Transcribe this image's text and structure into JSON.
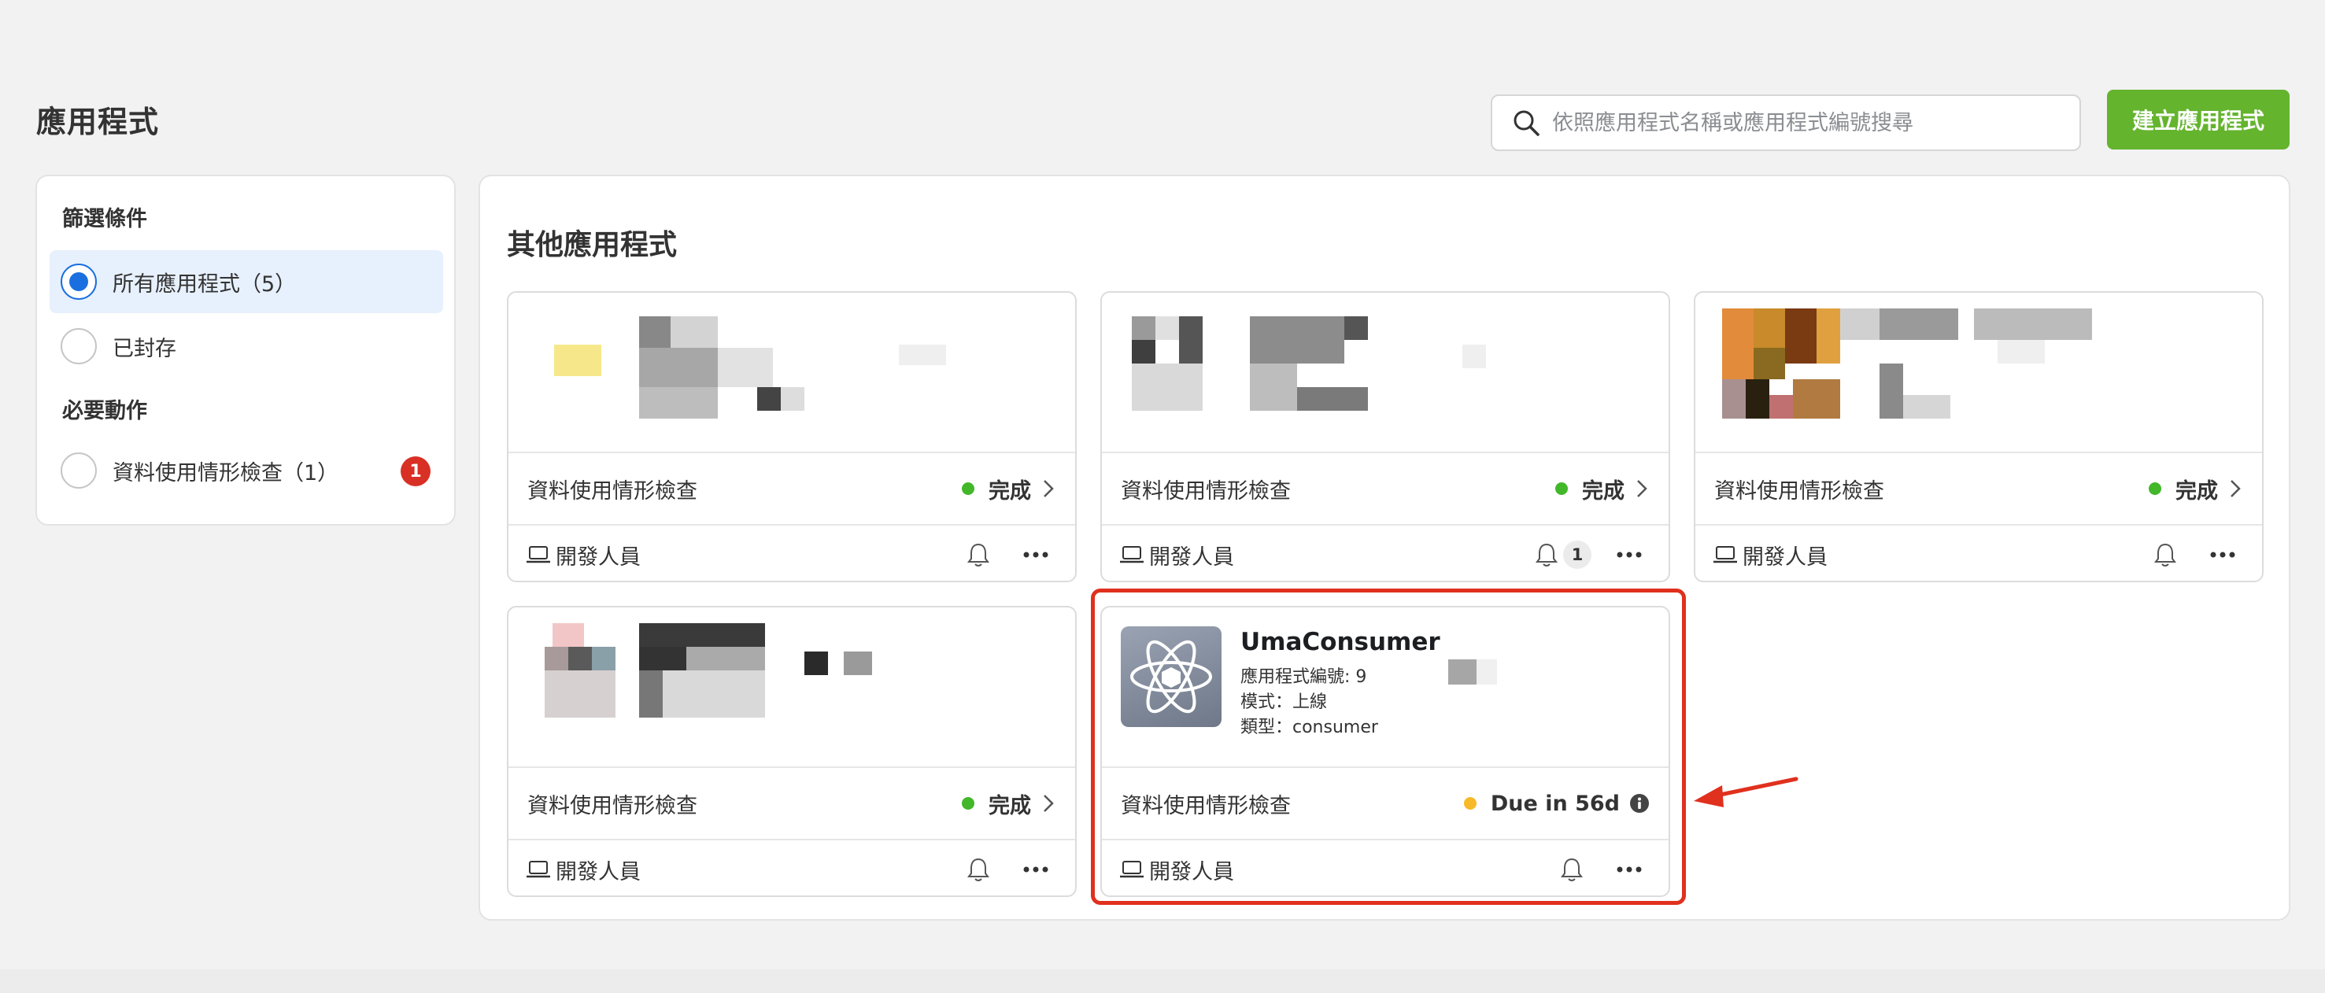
{
  "page": {
    "title": "應用程式"
  },
  "search": {
    "placeholder": "依照應用程式名稱或應用程式編號搜尋"
  },
  "header": {
    "create_label": "建立應用程式"
  },
  "sidebar": {
    "filter_title": "篩選條件",
    "items": [
      {
        "label": "所有應用程式（5）",
        "selected": true
      },
      {
        "label": "已封存",
        "selected": false
      }
    ],
    "required_title": "必要動作",
    "required_items": [
      {
        "label": "資料使用情形檢查（1）",
        "badge": "1"
      }
    ]
  },
  "main": {
    "section_title": "其他應用程式",
    "cards": [
      {
        "review_label": "資料使用情形檢查",
        "status": "完成",
        "role": "開發人員"
      },
      {
        "review_label": "資料使用情形檢查",
        "status": "完成",
        "role": "開發人員",
        "notif_count": "1"
      },
      {
        "review_label": "資料使用情形檢查",
        "status": "完成",
        "role": "開發人員"
      },
      {
        "review_label": "資料使用情形檢查",
        "status": "完成",
        "role": "開發人員"
      },
      {
        "name": "UmaConsumer",
        "app_id_label": "應用程式編號: 9",
        "mode_label": "模式：上線",
        "type_label": "類型：consumer",
        "review_label": "資料使用情形檢查",
        "status": "Due in 56d",
        "role": "開發人員"
      }
    ]
  },
  "colors": {
    "accent_green": "#64b42e",
    "status_done": "#42b72a",
    "status_due": "#f7b928",
    "highlight_red": "#e0301e",
    "selected_bg": "#e7f0fd"
  }
}
